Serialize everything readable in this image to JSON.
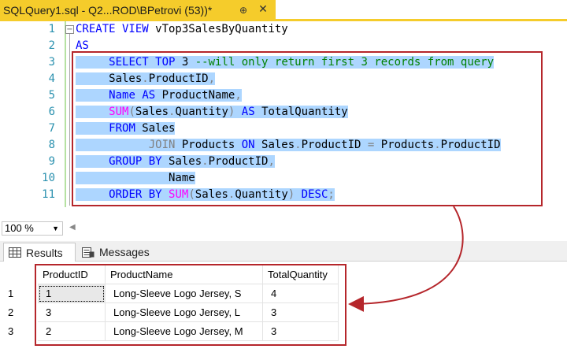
{
  "tab": {
    "title": "SQLQuery1.sql - Q2...ROD\\BPetrovi (53))*",
    "pin_glyph": "⊕",
    "close_glyph": "✕"
  },
  "editor": {
    "line_numbers": [
      "1",
      "2",
      "3",
      "4",
      "5",
      "6",
      "7",
      "8",
      "9",
      "10",
      "11"
    ],
    "fold_glyph": "−",
    "lines": [
      {
        "segments": [
          {
            "t": "CREATE VIEW",
            "c": "kw"
          },
          {
            "t": " vTop3SalesByQuantity",
            "c": ""
          }
        ]
      },
      {
        "segments": [
          {
            "t": "AS",
            "c": "kw"
          }
        ]
      },
      {
        "segments": [
          {
            "t": "     ",
            "c": ""
          },
          {
            "t": "SELECT TOP",
            "c": "kw"
          },
          {
            "t": " 3 ",
            "c": ""
          },
          {
            "t": "--will only return first 3 records from query",
            "c": "cm"
          }
        ]
      },
      {
        "segments": [
          {
            "t": "     Sales",
            "c": ""
          },
          {
            "t": ".",
            "c": "gray"
          },
          {
            "t": "ProductID",
            "c": ""
          },
          {
            "t": ",",
            "c": "gray"
          }
        ]
      },
      {
        "segments": [
          {
            "t": "     ",
            "c": ""
          },
          {
            "t": "Name",
            "c": "kw"
          },
          {
            "t": " ",
            "c": ""
          },
          {
            "t": "AS",
            "c": "kw"
          },
          {
            "t": " ProductName",
            "c": ""
          },
          {
            "t": ",",
            "c": "gray"
          }
        ]
      },
      {
        "segments": [
          {
            "t": "     ",
            "c": ""
          },
          {
            "t": "SUM",
            "c": "fn"
          },
          {
            "t": "(",
            "c": "gray"
          },
          {
            "t": "Sales",
            "c": ""
          },
          {
            "t": ".",
            "c": "gray"
          },
          {
            "t": "Quantity",
            "c": ""
          },
          {
            "t": ")",
            "c": "gray"
          },
          {
            "t": " ",
            "c": ""
          },
          {
            "t": "AS",
            "c": "kw"
          },
          {
            "t": " TotalQuantity",
            "c": ""
          }
        ]
      },
      {
        "segments": [
          {
            "t": "     ",
            "c": ""
          },
          {
            "t": "FROM",
            "c": "kw"
          },
          {
            "t": " Sales",
            "c": ""
          }
        ]
      },
      {
        "segments": [
          {
            "t": "           ",
            "c": ""
          },
          {
            "t": "JOIN",
            "c": "gray"
          },
          {
            "t": " Products ",
            "c": ""
          },
          {
            "t": "ON",
            "c": "kw"
          },
          {
            "t": " Sales",
            "c": ""
          },
          {
            "t": ".",
            "c": "gray"
          },
          {
            "t": "ProductID ",
            "c": ""
          },
          {
            "t": "=",
            "c": "gray"
          },
          {
            "t": " Products",
            "c": ""
          },
          {
            "t": ".",
            "c": "gray"
          },
          {
            "t": "ProductID",
            "c": ""
          }
        ]
      },
      {
        "segments": [
          {
            "t": "     ",
            "c": ""
          },
          {
            "t": "GROUP BY",
            "c": "kw"
          },
          {
            "t": " Sales",
            "c": ""
          },
          {
            "t": ".",
            "c": "gray"
          },
          {
            "t": "ProductID",
            "c": ""
          },
          {
            "t": ",",
            "c": "gray"
          }
        ]
      },
      {
        "segments": [
          {
            "t": "              Name",
            "c": ""
          }
        ]
      },
      {
        "segments": [
          {
            "t": "     ",
            "c": ""
          },
          {
            "t": "ORDER BY",
            "c": "kw"
          },
          {
            "t": " ",
            "c": ""
          },
          {
            "t": "SUM",
            "c": "fn"
          },
          {
            "t": "(",
            "c": "gray"
          },
          {
            "t": "Sales",
            "c": ""
          },
          {
            "t": ".",
            "c": "gray"
          },
          {
            "t": "Quantity",
            "c": ""
          },
          {
            "t": ")",
            "c": "gray"
          },
          {
            "t": " ",
            "c": ""
          },
          {
            "t": "DESC",
            "c": "kw"
          },
          {
            "t": ";",
            "c": "gray"
          }
        ]
      }
    ]
  },
  "zoom": {
    "value": "100 %",
    "arrow": "▼",
    "scroll_left": "◀"
  },
  "results_tabs": [
    {
      "label": "Results",
      "active": true
    },
    {
      "label": "Messages",
      "active": false
    }
  ],
  "grid": {
    "columns": [
      "ProductID",
      "ProductName",
      "TotalQuantity"
    ],
    "rows": [
      {
        "num": "1",
        "cells": [
          "1",
          "Long-Sleeve Logo Jersey, S",
          "4"
        ]
      },
      {
        "num": "2",
        "cells": [
          "3",
          "Long-Sleeve Logo Jersey, L",
          "3"
        ]
      },
      {
        "num": "3",
        "cells": [
          "2",
          "Long-Sleeve Logo Jersey, M",
          "3"
        ]
      }
    ]
  },
  "colors": {
    "tab_accent": "#f5cc2b",
    "selection": "#add6ff",
    "keyword": "#0000ff",
    "function": "#ff00ff",
    "comment": "#008000",
    "line_number": "#2b91af",
    "callout": "#b5262b"
  }
}
